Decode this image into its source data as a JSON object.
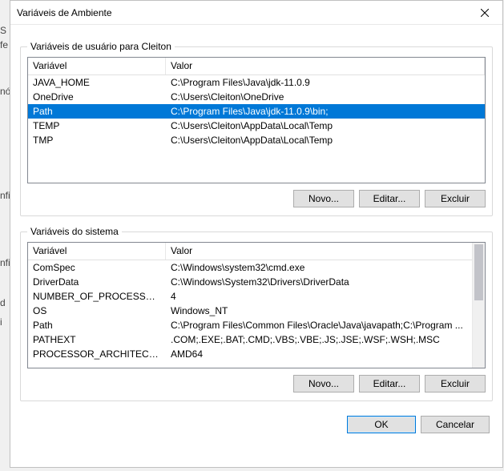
{
  "bgFragments": [
    "S",
    "fe",
    "nó",
    "nfi",
    "nfi",
    "d",
    "i"
  ],
  "window": {
    "title": "Variáveis de Ambiente"
  },
  "userSection": {
    "legend": "Variáveis de usuário para Cleiton",
    "headers": {
      "variable": "Variável",
      "value": "Valor"
    },
    "rows": [
      {
        "variable": "JAVA_HOME",
        "value": "C:\\Program Files\\Java\\jdk-11.0.9",
        "selected": false
      },
      {
        "variable": "OneDrive",
        "value": "C:\\Users\\Cleiton\\OneDrive",
        "selected": false
      },
      {
        "variable": "Path",
        "value": "C:\\Program Files\\Java\\jdk-11.0.9\\bin;",
        "selected": true
      },
      {
        "variable": "TEMP",
        "value": "C:\\Users\\Cleiton\\AppData\\Local\\Temp",
        "selected": false
      },
      {
        "variable": "TMP",
        "value": "C:\\Users\\Cleiton\\AppData\\Local\\Temp",
        "selected": false
      }
    ],
    "buttons": {
      "new": "Novo...",
      "edit": "Editar...",
      "delete": "Excluir"
    }
  },
  "systemSection": {
    "legend": "Variáveis do sistema",
    "headers": {
      "variable": "Variável",
      "value": "Valor"
    },
    "rows": [
      {
        "variable": "ComSpec",
        "value": "C:\\Windows\\system32\\cmd.exe"
      },
      {
        "variable": "DriverData",
        "value": "C:\\Windows\\System32\\Drivers\\DriverData"
      },
      {
        "variable": "NUMBER_OF_PROCESSORS",
        "value": "4"
      },
      {
        "variable": "OS",
        "value": "Windows_NT"
      },
      {
        "variable": "Path",
        "value": "C:\\Program Files\\Common Files\\Oracle\\Java\\javapath;C:\\Program ..."
      },
      {
        "variable": "PATHEXT",
        "value": ".COM;.EXE;.BAT;.CMD;.VBS;.VBE;.JS;.JSE;.WSF;.WSH;.MSC"
      },
      {
        "variable": "PROCESSOR_ARCHITECTURE",
        "value": "AMD64"
      }
    ],
    "buttons": {
      "new": "Novo...",
      "edit": "Editar...",
      "delete": "Excluir"
    }
  },
  "dialogButtons": {
    "ok": "OK",
    "cancel": "Cancelar"
  }
}
